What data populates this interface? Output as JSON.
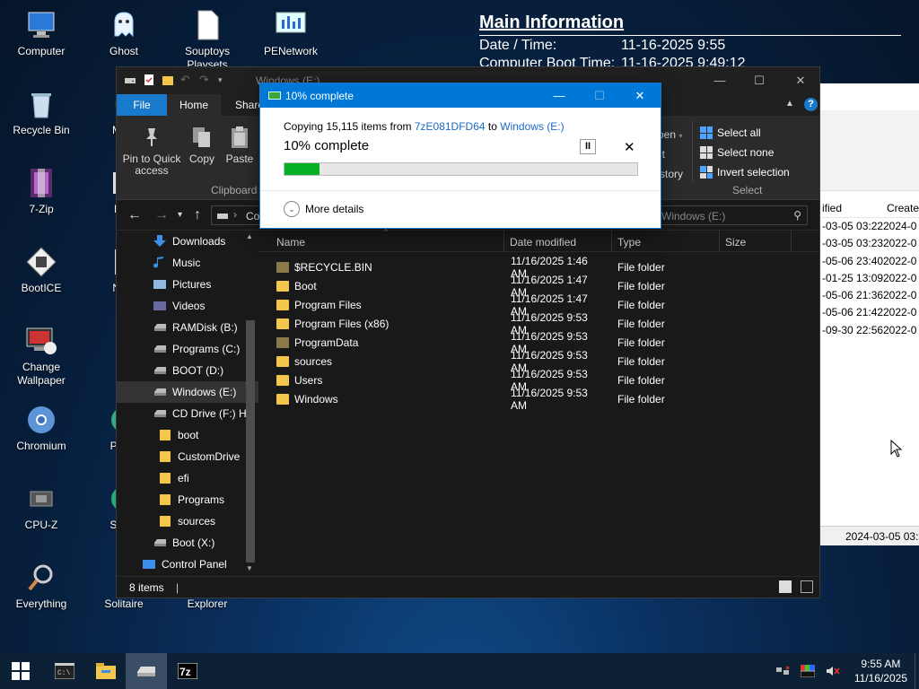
{
  "desktop_icons": [
    {
      "label": "Computer",
      "icon": "computer-icon"
    },
    {
      "label": "Ghost",
      "icon": "ghost-icon"
    },
    {
      "label": "Souptoys Playsets",
      "icon": "document-icon"
    },
    {
      "label": "PENetwork",
      "icon": "network-icon"
    },
    {
      "label": "Recycle Bin",
      "icon": "recycle-bin-icon"
    },
    {
      "label": "Mine",
      "icon": "minesweeper-icon"
    },
    {
      "label": "7-Zip",
      "icon": "7zip-icon"
    },
    {
      "label": "NirL",
      "icon": "nirlauncher-icon"
    },
    {
      "label": "BootICE",
      "icon": "bootice-icon"
    },
    {
      "label": "Note",
      "icon": "notepad-icon"
    },
    {
      "label": "Change Wallpaper",
      "icon": "wallpaper-icon"
    },
    {
      "label": "P",
      "icon": "app-icon"
    },
    {
      "label": "Chromium",
      "icon": "chromium-icon"
    },
    {
      "label": "Partiti",
      "icon": "partition-icon"
    },
    {
      "label": "CPU-Z",
      "icon": "cpu-icon"
    },
    {
      "label": "Setup",
      "icon": "setup-icon"
    },
    {
      "label": "Everything",
      "icon": "search-icon"
    },
    {
      "label": "Solitaire",
      "icon": "solitaire-icon"
    },
    {
      "label": "Explorer",
      "icon": "explorer-icon"
    }
  ],
  "info_overlay": {
    "title": "Main Information",
    "rows": [
      {
        "key": "Date / Time:",
        "value": "11-16-2025 9:55"
      },
      {
        "key": "Computer Boot Time:",
        "value": "11-16-2025 9:49:12"
      }
    ]
  },
  "background_window": {
    "columns": [
      "ified",
      "Create"
    ],
    "rows": [
      [
        "-03-05 03:22",
        "2024-0"
      ],
      [
        "-03-05 03:23",
        "2022-0"
      ],
      [
        "-05-06 23:40",
        "2022-0"
      ],
      [
        "-01-25 13:09",
        "2022-0"
      ],
      [
        "-05-06 21:36",
        "2022-0"
      ],
      [
        "-05-06 21:42",
        "2022-0"
      ],
      [
        "-09-30 22:56",
        "2022-0"
      ]
    ],
    "footer": "2024-03-05 03:2"
  },
  "explorer": {
    "title": "Windows (E:)",
    "tabs": {
      "file": "File",
      "home": "Home",
      "share": "Share"
    },
    "ribbon": {
      "pin": "Pin to Quick access",
      "copy": "Copy",
      "paste": "Paste",
      "clipboard_group": "Clipboard",
      "open_partial": "pen",
      "edit_partial": "it",
      "history_partial": "story",
      "select_all": "Select all",
      "select_none": "Select none",
      "invert_selection": "Invert selection",
      "select_group": "Select"
    },
    "address_partial": "Co",
    "search_placeholder": "h Windows (E:)",
    "nav_items": [
      {
        "label": "Downloads",
        "indent": 1,
        "icon": "downloads-icon",
        "color": "#3b8eea"
      },
      {
        "label": "Music",
        "indent": 1,
        "icon": "music-icon",
        "color": "#3b8eea"
      },
      {
        "label": "Pictures",
        "indent": 1,
        "icon": "pictures-icon",
        "color": "#8fb8e0"
      },
      {
        "label": "Videos",
        "indent": 1,
        "icon": "videos-icon",
        "color": "#6a6aa0"
      },
      {
        "label": "RAMDisk (B:)",
        "indent": 1,
        "icon": "drive-icon",
        "color": "#bbbbbb"
      },
      {
        "label": "Programs (C:)",
        "indent": 1,
        "icon": "drive-icon",
        "color": "#bbbbbb"
      },
      {
        "label": "BOOT (D:)",
        "indent": 1,
        "icon": "drive-icon",
        "color": "#bbbbbb"
      },
      {
        "label": "Windows (E:)",
        "indent": 1,
        "icon": "drive-icon",
        "color": "#bbbbbb",
        "active": true
      },
      {
        "label": "CD Drive (F:) H",
        "indent": 1,
        "icon": "cd-drive-icon",
        "color": "#bbbbbb"
      },
      {
        "label": "boot",
        "indent": 2,
        "icon": "folder-icon",
        "color": "#f3c74c"
      },
      {
        "label": "CustomDrive",
        "indent": 2,
        "icon": "folder-icon",
        "color": "#f3c74c"
      },
      {
        "label": "efi",
        "indent": 2,
        "icon": "folder-icon",
        "color": "#f3c74c"
      },
      {
        "label": "Programs",
        "indent": 2,
        "icon": "folder-icon",
        "color": "#f3c74c"
      },
      {
        "label": "sources",
        "indent": 2,
        "icon": "folder-icon",
        "color": "#f3c74c"
      },
      {
        "label": "Boot (X:)",
        "indent": 1,
        "icon": "drive-icon",
        "color": "#bbbbbb"
      },
      {
        "label": "Control Panel",
        "indent": 0,
        "icon": "control-panel-icon",
        "color": "#3b8eea"
      }
    ],
    "columns": {
      "name": "Name",
      "date": "Date modified",
      "type": "Type",
      "size": "Size"
    },
    "files": [
      {
        "name": "$RECYCLE.BIN",
        "date": "11/16/2025 1:46 AM",
        "type": "File folder",
        "color": "#8a7a4a"
      },
      {
        "name": "Boot",
        "date": "11/16/2025 1:47 AM",
        "type": "File folder",
        "color": "#f3c74c"
      },
      {
        "name": "Program Files",
        "date": "11/16/2025 1:47 AM",
        "type": "File folder",
        "color": "#f3c74c"
      },
      {
        "name": "Program Files (x86)",
        "date": "11/16/2025 9:53 AM",
        "type": "File folder",
        "color": "#f3c74c"
      },
      {
        "name": "ProgramData",
        "date": "11/16/2025 9:53 AM",
        "type": "File folder",
        "color": "#8a7a4a"
      },
      {
        "name": "sources",
        "date": "11/16/2025 9:53 AM",
        "type": "File folder",
        "color": "#f3c74c"
      },
      {
        "name": "Users",
        "date": "11/16/2025 9:53 AM",
        "type": "File folder",
        "color": "#f3c74c"
      },
      {
        "name": "Windows",
        "date": "11/16/2025 9:53 AM",
        "type": "File folder",
        "color": "#f3c74c"
      }
    ],
    "status": "8 items"
  },
  "copy_dialog": {
    "title": "10% complete",
    "copying_prefix": "Copying 15,115 items from ",
    "source": "7zE081DFD64",
    "to_word": " to ",
    "destination": "Windows (E:)",
    "percent_text": "10% complete",
    "progress": 0.1,
    "pause_label": "II",
    "cancel_label": "✕",
    "more_details": "More details"
  },
  "taskbar": {
    "items": [
      {
        "icon": "start-icon"
      },
      {
        "icon": "terminal-icon"
      },
      {
        "icon": "file-explorer-icon"
      },
      {
        "icon": "drive-icon",
        "active": true
      },
      {
        "icon": "7zip-icon"
      }
    ],
    "clock_time": "9:55 AM",
    "clock_date": "11/16/2025"
  },
  "colors": {
    "accent": "#0078d7",
    "progress_green": "#06b025",
    "folder_yellow": "#f3c74c",
    "dark_bg": "#191919"
  }
}
